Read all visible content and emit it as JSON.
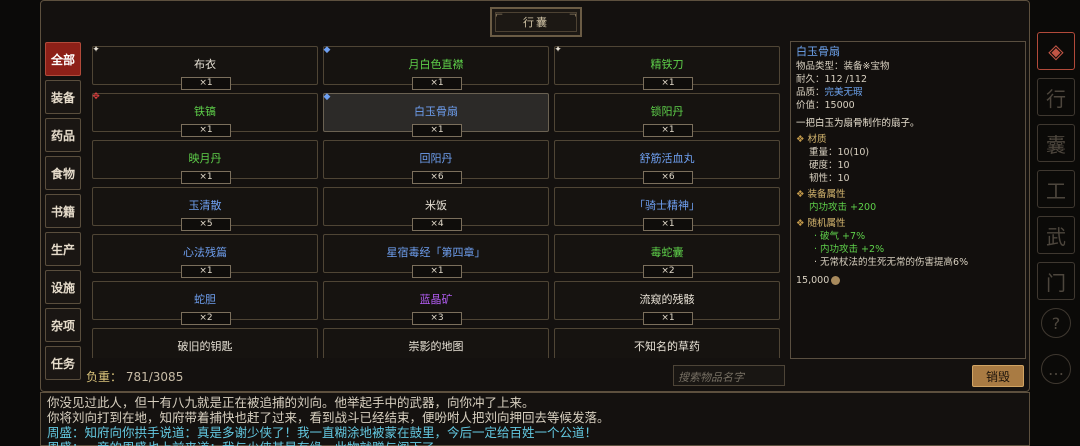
{
  "title": "行囊",
  "tabs": [
    "全部",
    "装备",
    "药品",
    "食物",
    "书籍",
    "生产",
    "设施",
    "杂项",
    "任务"
  ],
  "active_tab": 0,
  "items": [
    {
      "name": "布衣",
      "qty": "×1",
      "quality": "white",
      "grade": "common"
    },
    {
      "name": "月白色直襟",
      "qty": "×1",
      "quality": "green",
      "grade": "rare"
    },
    {
      "name": "精铁刀",
      "qty": "×1",
      "quality": "green",
      "grade": "common"
    },
    {
      "name": "铁镐",
      "qty": "×1",
      "quality": "green",
      "grade": "epic"
    },
    {
      "name": "白玉骨扇",
      "qty": "×1",
      "quality": "blue",
      "grade": "rare",
      "selected": true
    },
    {
      "name": "锁阳丹",
      "qty": "×1",
      "quality": "green"
    },
    {
      "name": "映月丹",
      "qty": "×1",
      "quality": "green"
    },
    {
      "name": "回阳丹",
      "qty": "×6",
      "quality": "blue"
    },
    {
      "name": "舒筋活血丸",
      "qty": "×6",
      "quality": "blue"
    },
    {
      "name": "玉清散",
      "qty": "×5",
      "quality": "blue"
    },
    {
      "name": "米饭",
      "qty": "×4",
      "quality": "white"
    },
    {
      "name": "「骑士精神」",
      "qty": "×1",
      "quality": "blue"
    },
    {
      "name": "心法残篇",
      "qty": "×1",
      "quality": "blue"
    },
    {
      "name": "星宿毒经「第四章」",
      "qty": "×1",
      "quality": "blue"
    },
    {
      "name": "毒蛇囊",
      "qty": "×2",
      "quality": "green"
    },
    {
      "name": "蛇胆",
      "qty": "×2",
      "quality": "blue"
    },
    {
      "name": "蓝晶矿",
      "qty": "×3",
      "quality": "purple"
    },
    {
      "name": "流窥的残骸",
      "qty": "×1",
      "quality": "white"
    },
    {
      "name": "破旧的钥匙",
      "qty": "",
      "quality": "white"
    },
    {
      "name": "崇影的地图",
      "qty": "",
      "quality": "white"
    },
    {
      "name": "不知名的草药",
      "qty": "",
      "quality": "white"
    }
  ],
  "weight": {
    "label": "负重：",
    "value": "781/3085"
  },
  "search": {
    "placeholder": "搜索物品名字"
  },
  "destroy_label": "销毁",
  "detail": {
    "name": "白玉骨扇",
    "type_label": "物品类型：",
    "type_value": "装备※宝物",
    "durability": "耐久：112 /112",
    "grade_label": "品质：",
    "grade_value": "完美无瑕",
    "price": "价值：15000",
    "desc": "一把白玉为扇骨制作的扇子。",
    "material_header": "材质",
    "material": [
      "重量：10(10)",
      "硬度：10",
      "韧性：10"
    ],
    "equip_header": "装备属性",
    "equip": [
      "内功攻击 +200"
    ],
    "random_header": "随机属性",
    "random_green": [
      "· 破气 +7%",
      "· 内功攻击 +2%"
    ],
    "random_plain": [
      "· 无常杖法的生死无常的伤害提高6%"
    ],
    "sell_price": "15,000"
  },
  "log": [
    "你没见过此人，但十有八九就是正在被追捕的刘向。他举起手中的武器，向你冲了上来。",
    "你将刘向打到在地，知府带着捕快也赶了过来，看到战斗已经结束，便吩咐人把刘向押回去等候发落。",
    "周盛：知府向你拱手说道：真是多谢少侠了！我一直糊涂地被蒙在鼓里，今后一定给百姓一个公道！",
    "周盛：一旁的周盛也上前来道：我与少侠甚是有缘，此物就赠与阁下了"
  ],
  "side_icons": [
    "diamond-arrow-icon",
    "xingdong-icon",
    "xingnang-icon",
    "gongzuo-icon",
    "wuxue-icon",
    "menpai-icon",
    "help-icon",
    "more-icon"
  ],
  "colors": {
    "accent_red": "#8d2018",
    "quality_green": "#5ed04a",
    "quality_blue": "#6e9ff0",
    "quality_purple": "#b05bf0",
    "log_cyan": "#63c8e0"
  }
}
